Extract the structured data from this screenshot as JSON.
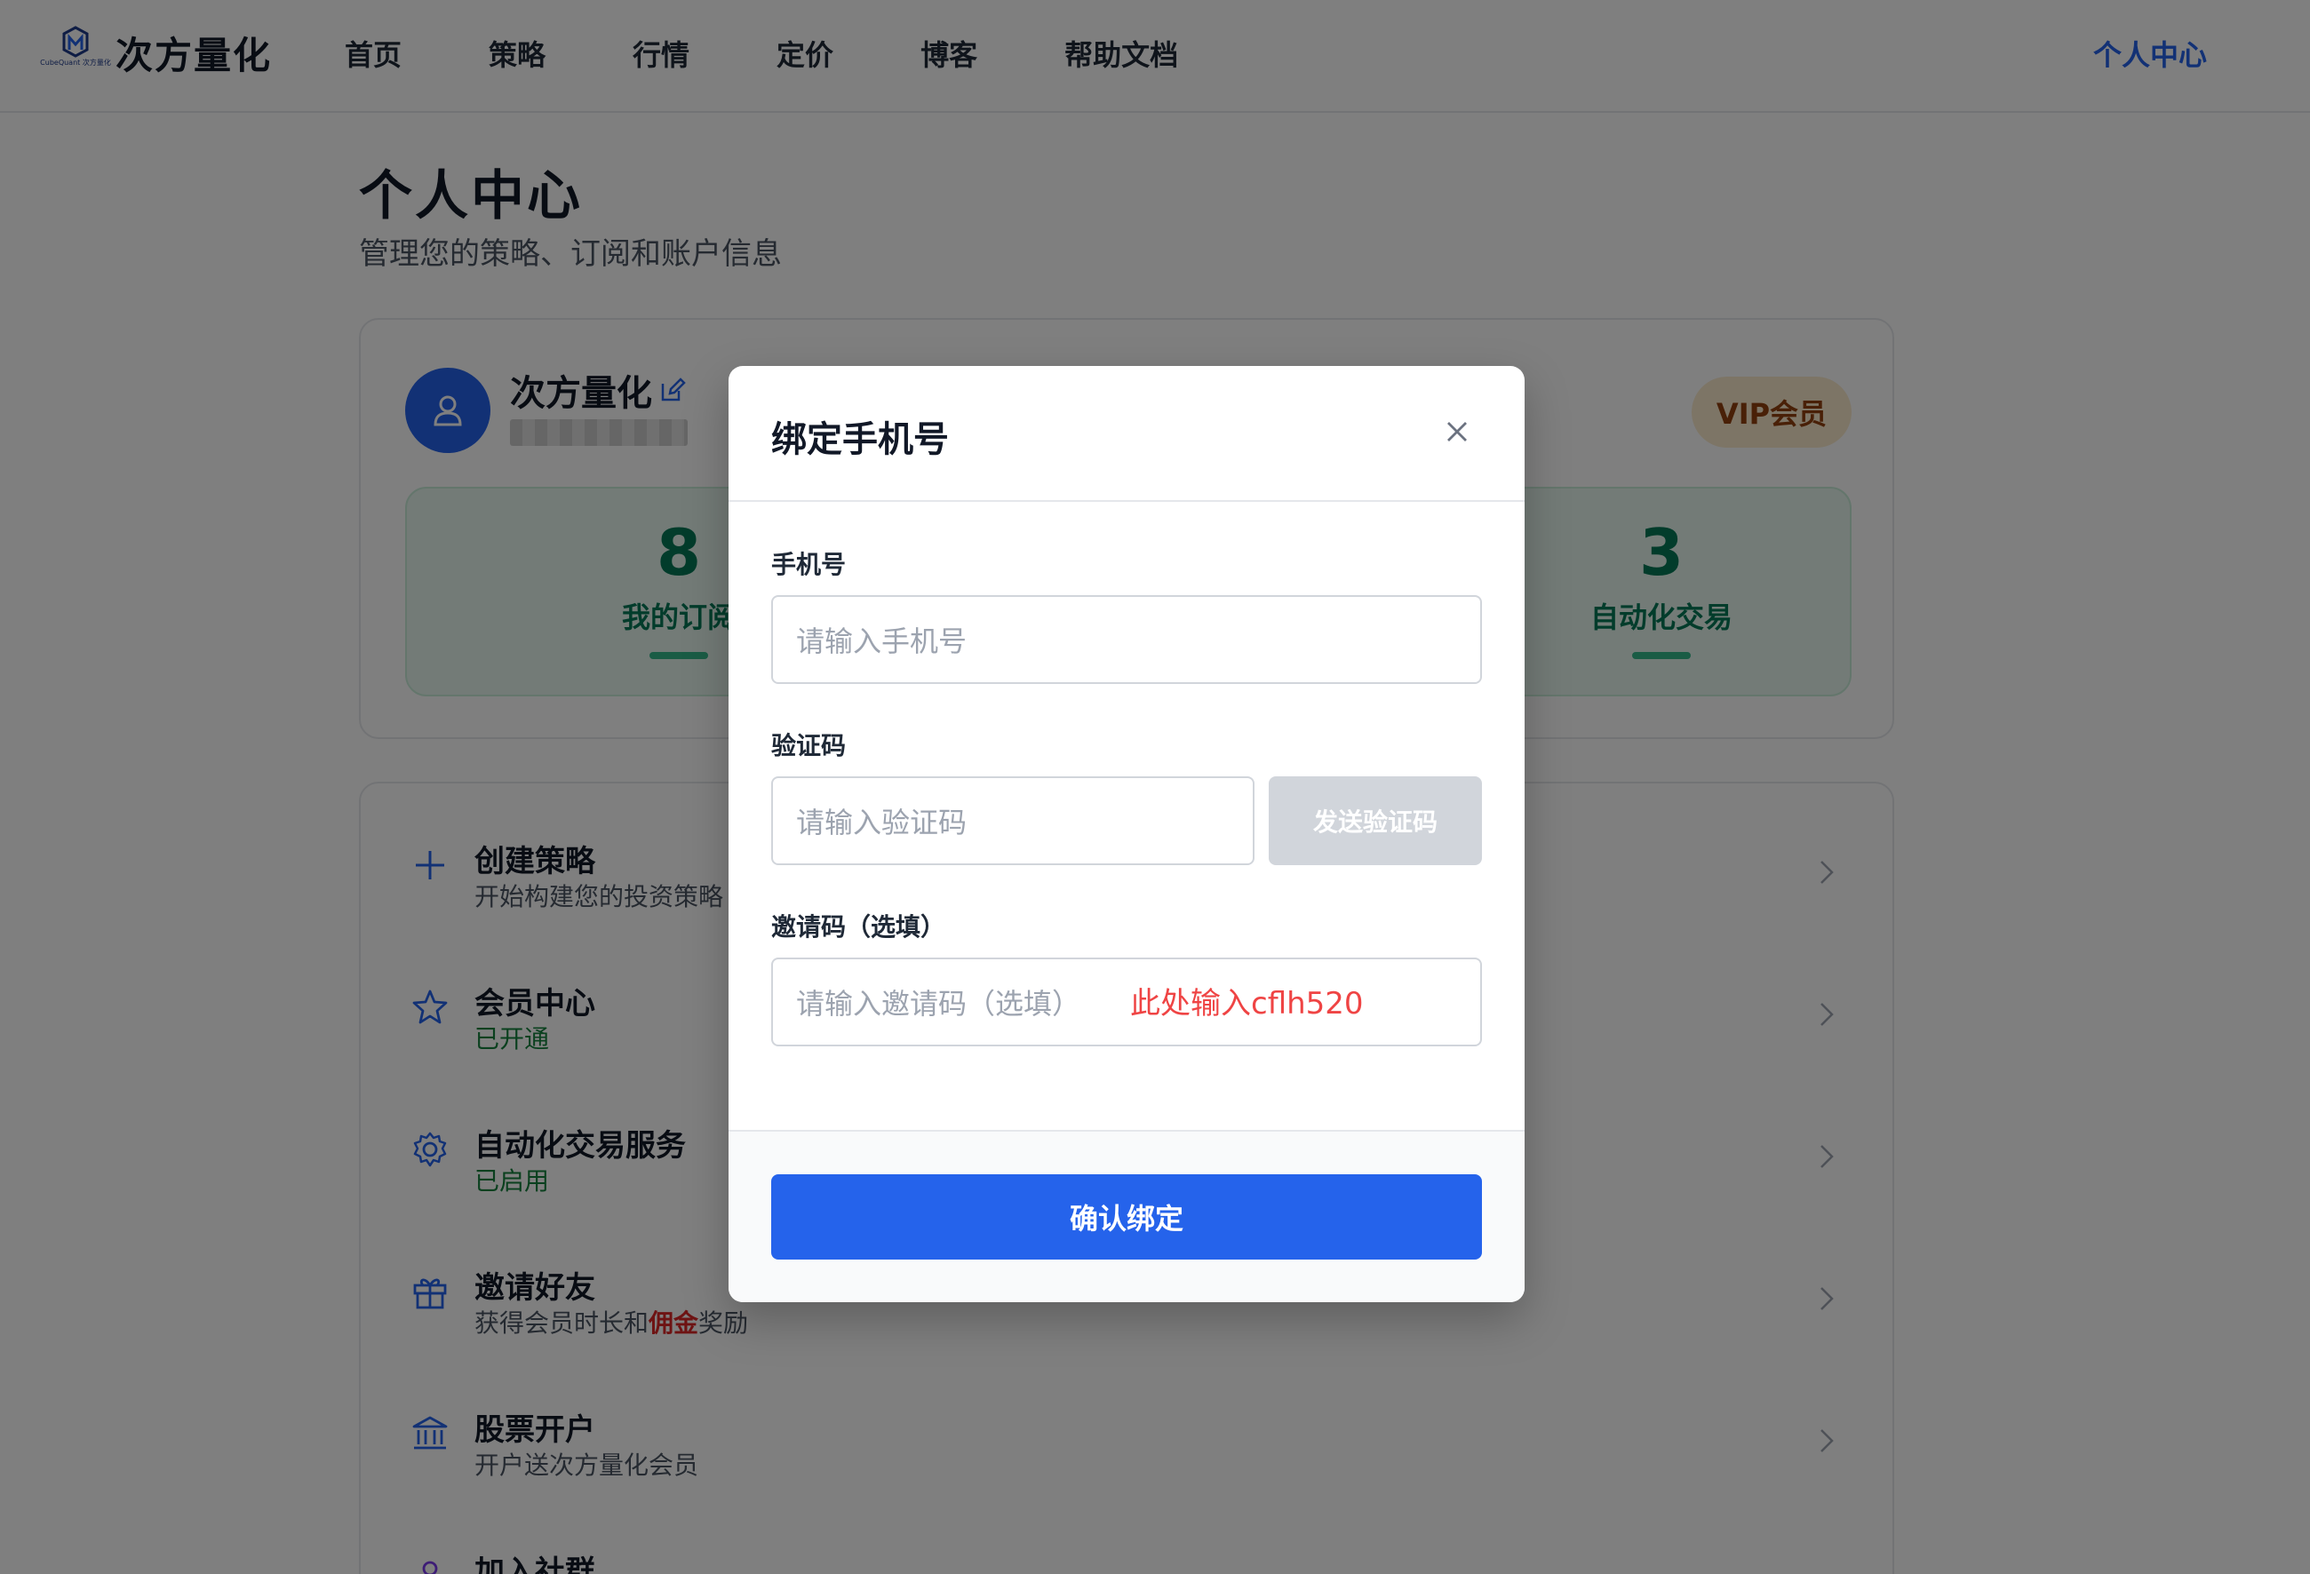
{
  "header": {
    "logo_sub": "CubeQuant 次方量化",
    "brand": "次方量化",
    "nav": [
      "首页",
      "策略",
      "行情",
      "定价",
      "博客",
      "帮助文档"
    ],
    "right": "个人中心"
  },
  "page": {
    "title": "个人中心",
    "subtitle": "管理您的策略、订阅和账户信息"
  },
  "profile": {
    "name": "次方量化",
    "badge": "VIP会员",
    "stats": [
      {
        "value": "8",
        "label": "我的订阅"
      },
      {
        "value": "3",
        "label": "自动化交易"
      }
    ]
  },
  "menu": [
    {
      "title": "创建策略",
      "sub": "开始构建您的投资策略",
      "icon": "plus-icon"
    },
    {
      "title": "会员中心",
      "sub": "已开通",
      "icon": "star-icon"
    },
    {
      "title": "自动化交易服务",
      "sub": "已启用",
      "icon": "gear-icon"
    },
    {
      "title": "邀请好友",
      "sub_before": "获得会员时长和",
      "sub_highlight": "佣金",
      "sub_after": "奖励",
      "icon": "gift-icon"
    },
    {
      "title": "股票开户",
      "sub": "开户送次方量化会员",
      "icon": "bank-icon"
    },
    {
      "title": "加入社群",
      "icon": "user-group-icon"
    }
  ],
  "modal": {
    "title": "绑定手机号",
    "phone_label": "手机号",
    "phone_placeholder": "请输入手机号",
    "code_label": "验证码",
    "code_placeholder": "请输入验证码",
    "send_code": "发送验证码",
    "invite_label": "邀请码（选填）",
    "invite_placeholder": "请输入邀请码（选填）",
    "invite_hint": "此处输入cflh520",
    "confirm": "确认绑定"
  },
  "colors": {
    "primary": "#2563eb",
    "success": "#047857",
    "vip_bg": "#fbeacc",
    "hint_red": "#ef4444"
  }
}
